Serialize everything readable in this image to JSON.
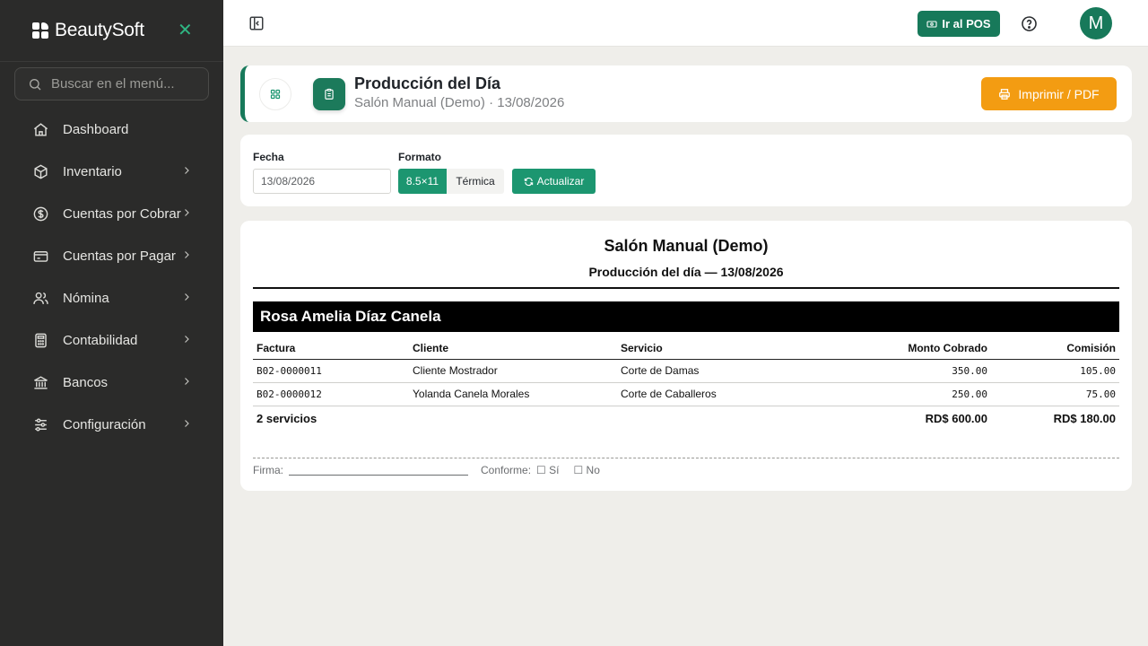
{
  "sidebar": {
    "brand": "BeautySoft",
    "search_placeholder": "Buscar en el menú...",
    "items": [
      {
        "label": "Dashboard",
        "icon": "home-icon"
      },
      {
        "label": "Inventario",
        "icon": "box-icon"
      },
      {
        "label": "Cuentas por Cobrar",
        "icon": "dollar-circle-icon"
      },
      {
        "label": "Cuentas por Pagar",
        "icon": "credit-card-icon"
      },
      {
        "label": "Nómina",
        "icon": "users-icon"
      },
      {
        "label": "Contabilidad",
        "icon": "calculator-icon"
      },
      {
        "label": "Bancos",
        "icon": "bank-icon"
      },
      {
        "label": "Configuración",
        "icon": "sliders-icon"
      }
    ]
  },
  "topbar": {
    "pos_label": "Ir al POS",
    "avatar_initial": "M"
  },
  "header": {
    "title": "Producción del Día",
    "subtitle": "Salón Manual (Demo) · 13/08/2026",
    "print_label": "Imprimir / PDF"
  },
  "filters": {
    "date_label": "Fecha",
    "date_value": "13/08/2026",
    "format_label": "Formato",
    "format_options": [
      "8.5×11",
      "Térmica"
    ],
    "refresh_label": "Actualizar"
  },
  "report": {
    "title": "Salón Manual (Demo)",
    "subtitle": "Producción del día — 13/08/2026",
    "employee": "Rosa Amelia Díaz Canela",
    "columns": [
      "Factura",
      "Cliente",
      "Servicio",
      "Monto Cobrado",
      "Comisión"
    ],
    "rows": [
      {
        "factura": "B02-0000011",
        "cliente": "Cliente Mostrador",
        "servicio": "Corte de Damas",
        "monto": "350.00",
        "comision": "105.00"
      },
      {
        "factura": "B02-0000012",
        "cliente": "Yolanda Canela Morales",
        "servicio": "Corte de Caballeros",
        "monto": "250.00",
        "comision": "75.00"
      }
    ],
    "total_label": "2 servicios",
    "total_monto": "RD$ 600.00",
    "total_comision": "RD$ 180.00",
    "firma_label": "Firma:",
    "conforme_label": "Conforme:",
    "si_label": "☐ Sí",
    "no_label": "☐ No"
  },
  "colors": {
    "sidebar_bg": "#2b2b2a",
    "brand_green": "#17795a",
    "accent_green": "#1c9670",
    "print_orange": "#f39c12"
  }
}
